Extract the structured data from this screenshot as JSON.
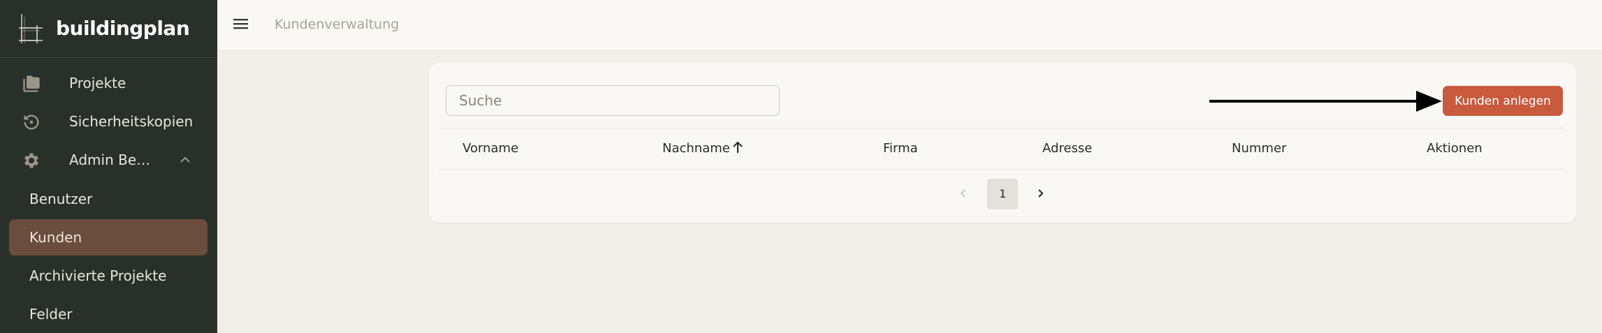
{
  "app": {
    "name": "buildingplan"
  },
  "sidebar": {
    "items": [
      {
        "label": "Projekte",
        "icon": "folder-icon"
      },
      {
        "label": "Sicherheitskopien",
        "icon": "history-icon"
      },
      {
        "label": "Admin Be…",
        "icon": "gear-icon",
        "expanded": true
      }
    ],
    "subitems": [
      {
        "label": "Benutzer"
      },
      {
        "label": "Kunden",
        "active": true
      },
      {
        "label": "Archivierte Projekte"
      },
      {
        "label": "Felder"
      }
    ]
  },
  "header": {
    "title": "Kundenverwaltung"
  },
  "search": {
    "placeholder": "Suche",
    "value": ""
  },
  "toolbar": {
    "create_label": "Kunden anlegen"
  },
  "table": {
    "columns": [
      "Vorname",
      "Nachname",
      "Firma",
      "Adresse",
      "Nummer",
      "Aktionen"
    ],
    "sorted_column": "Nachname",
    "sort_direction": "ascending",
    "rows": []
  },
  "pagination": {
    "current_page": "1"
  },
  "colors": {
    "sidebar_bg": "#29302a",
    "active_item_bg": "#6a4d3c",
    "primary_button": "#c85a3e",
    "page_bg": "#f2efe9",
    "card_bg": "#faf8f4"
  }
}
